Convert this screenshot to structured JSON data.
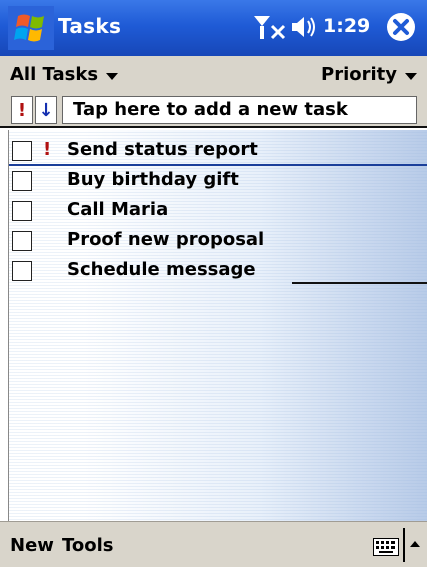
{
  "titlebar": {
    "app_title": "Tasks",
    "clock": "1:29",
    "icons": [
      "windows-flag-icon",
      "signal-off-icon",
      "volume-icon",
      "close-icon"
    ],
    "colors": {
      "bar": "#1f5bd6"
    }
  },
  "menu_row": {
    "filter_label": "All Tasks",
    "sort_label": "Priority"
  },
  "entry_bar": {
    "priority_glyph": "!",
    "sort_glyph": "↓",
    "new_task_placeholder": "Tap here to add a new task"
  },
  "tasks": [
    {
      "label": "Send status report",
      "priority": "!",
      "done": false,
      "selected": true
    },
    {
      "label": "Buy birthday gift",
      "priority": "",
      "done": false,
      "selected": false
    },
    {
      "label": "Call Maria",
      "priority": "",
      "done": false,
      "selected": false
    },
    {
      "label": "Proof new proposal",
      "priority": "",
      "done": false,
      "selected": false
    },
    {
      "label": "Schedule message",
      "priority": "",
      "done": false,
      "selected": false
    }
  ],
  "bottom_bar": {
    "new_label": "New",
    "tools_label": "Tools"
  }
}
